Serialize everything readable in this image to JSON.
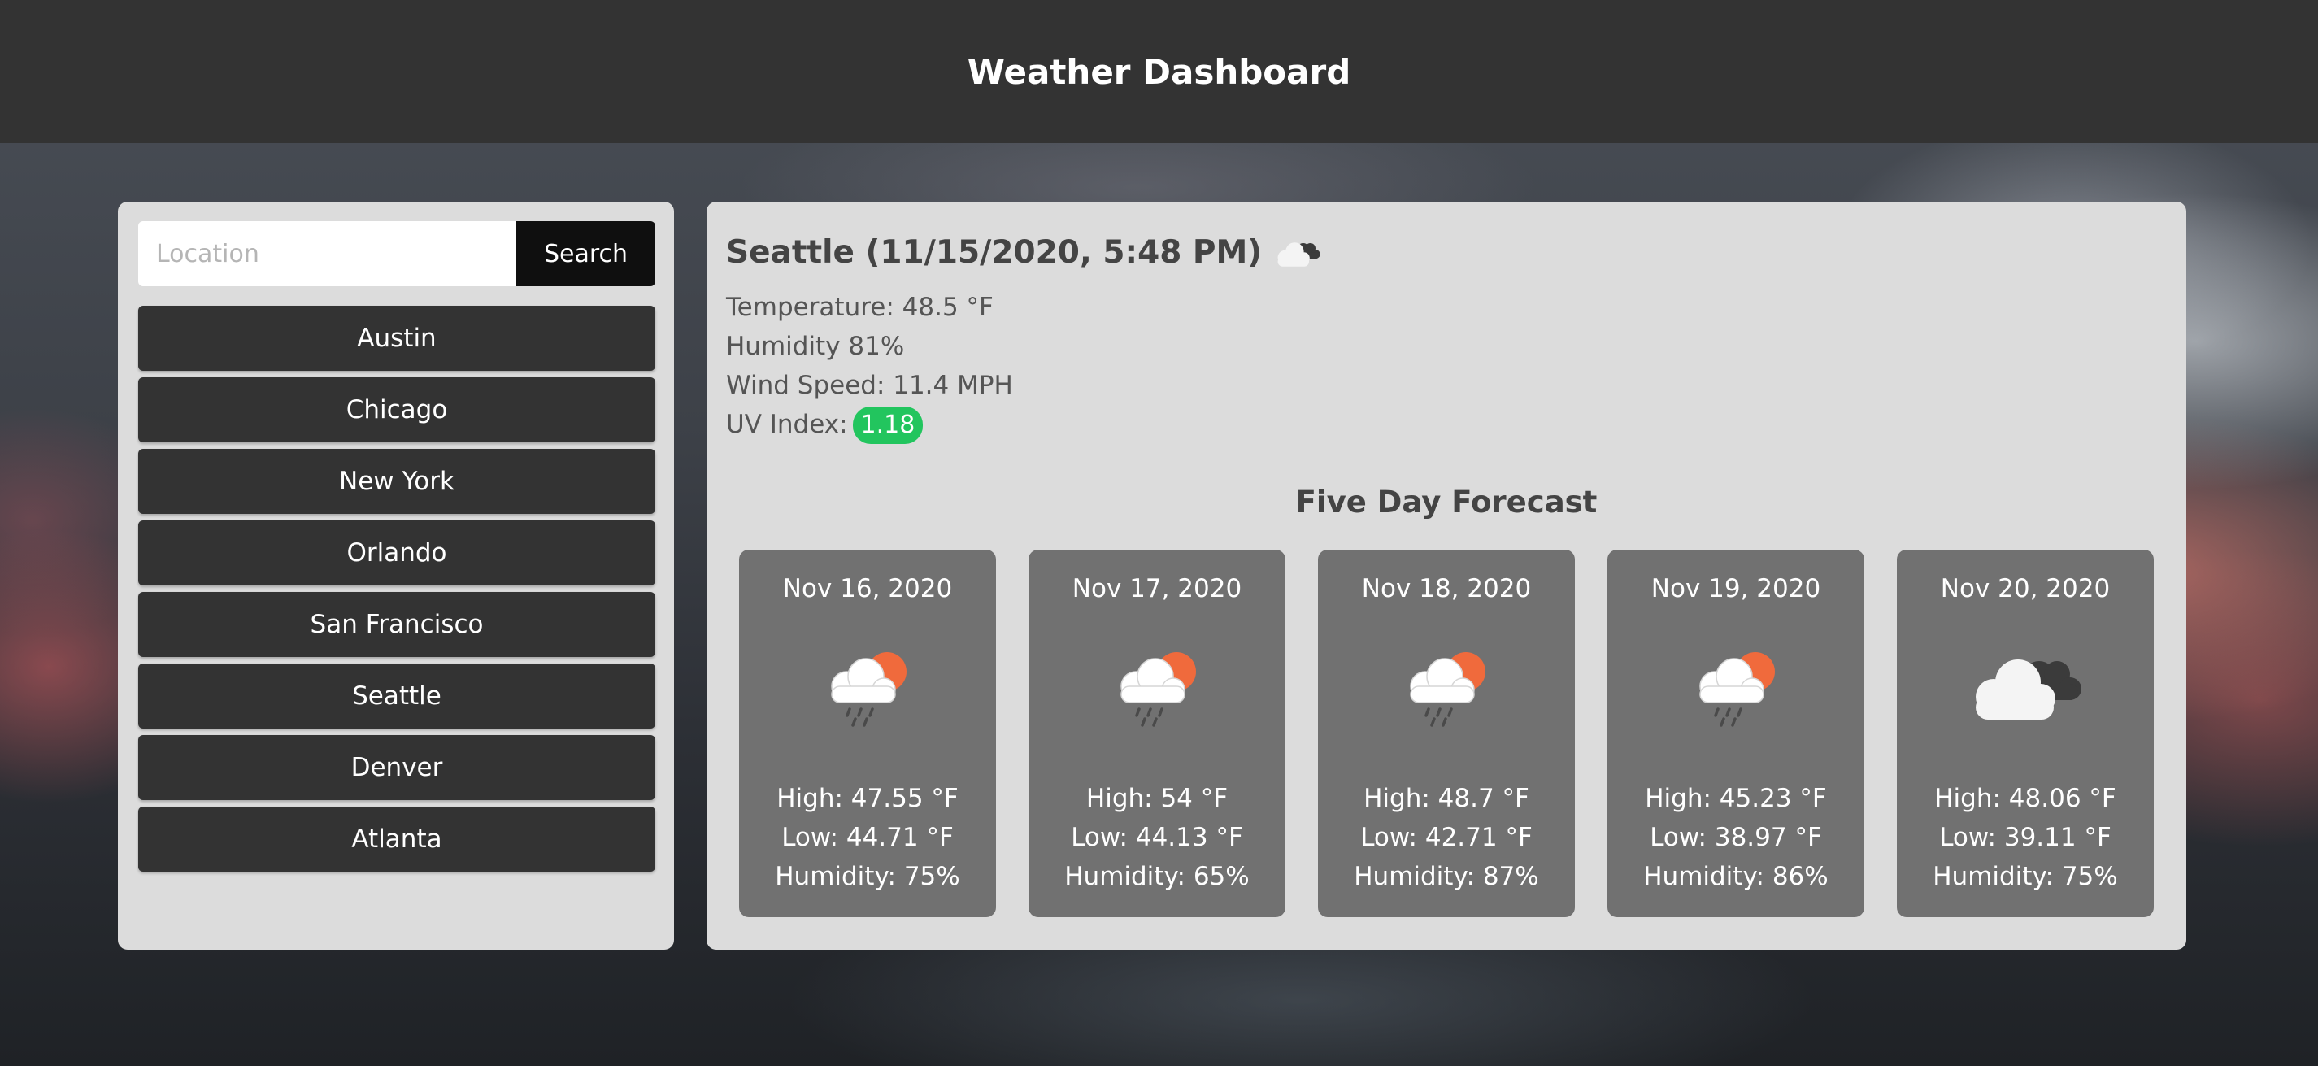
{
  "header": {
    "title": "Weather Dashboard"
  },
  "search": {
    "placeholder": "Location",
    "value": "",
    "button_label": "Search"
  },
  "cities": [
    "Austin",
    "Chicago",
    "New York",
    "Orlando",
    "San Francisco",
    "Seattle",
    "Denver",
    "Atlanta"
  ],
  "current": {
    "title": "Seattle (11/15/2020, 5:48 PM)",
    "icon": "broken-clouds-icon",
    "temperature": "Temperature: 48.5 °F",
    "humidity": "Humidity 81%",
    "wind": "Wind Speed: 11.4 MPH",
    "uv_label": "UV Index:",
    "uv_value": "1.18",
    "uv_color": "#22c55e"
  },
  "forecast": {
    "title": "Five Day Forecast",
    "days": [
      {
        "date": "Nov 16, 2020",
        "icon": "sun-rain-cloud-icon",
        "high": "High: 47.55 °F",
        "low": "Low: 44.71 °F",
        "humidity": "Humidity: 75%"
      },
      {
        "date": "Nov 17, 2020",
        "icon": "sun-rain-cloud-icon",
        "high": "High: 54 °F",
        "low": "Low: 44.13 °F",
        "humidity": "Humidity: 65%"
      },
      {
        "date": "Nov 18, 2020",
        "icon": "sun-rain-cloud-icon",
        "high": "High: 48.7 °F",
        "low": "Low: 42.71 °F",
        "humidity": "Humidity: 87%"
      },
      {
        "date": "Nov 19, 2020",
        "icon": "sun-rain-cloud-icon",
        "high": "High: 45.23 °F",
        "low": "Low: 38.97 °F",
        "humidity": "Humidity: 86%"
      },
      {
        "date": "Nov 20, 2020",
        "icon": "broken-clouds-icon",
        "high": "High: 48.06 °F",
        "low": "Low: 39.11 °F",
        "humidity": "Humidity: 75%"
      }
    ]
  },
  "colors": {
    "header_bg": "#333333",
    "panel_bg": "#dcdcdc",
    "card_bg": "#717171",
    "city_btn_bg": "#333333",
    "sun": "#f06a3c"
  }
}
